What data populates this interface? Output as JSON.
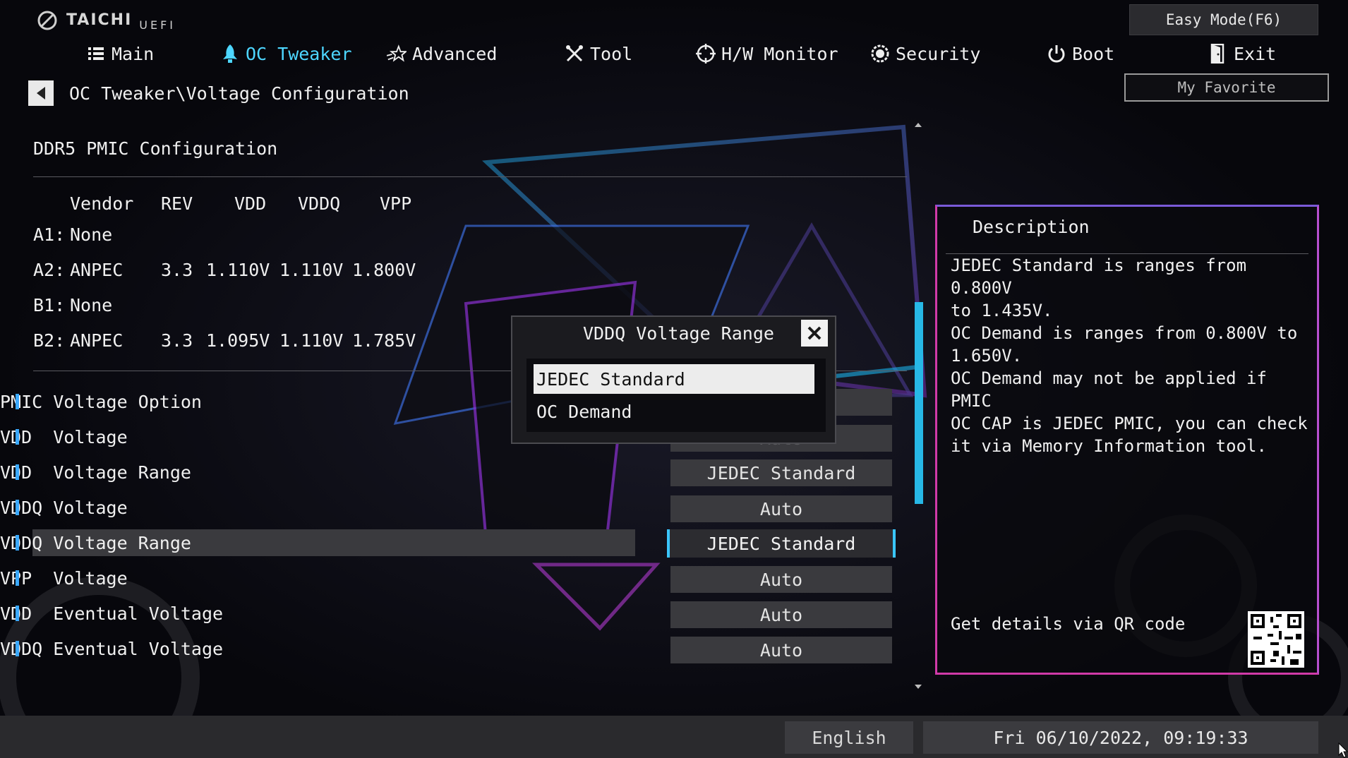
{
  "header": {
    "brand": "TAICHI",
    "brand_sub": "UEFI",
    "easy_mode": "Easy Mode(F6)",
    "my_favorite": "My Favorite"
  },
  "nav": [
    {
      "label": "Main",
      "icon": "list-icon"
    },
    {
      "label": "OC Tweaker",
      "icon": "rocket-icon",
      "active": true
    },
    {
      "label": "Advanced",
      "icon": "star-icon"
    },
    {
      "label": "Tool",
      "icon": "tools-icon"
    },
    {
      "label": "H/W Monitor",
      "icon": "crosshair-icon"
    },
    {
      "label": "Security",
      "icon": "shield-icon"
    },
    {
      "label": "Boot",
      "icon": "power-icon"
    },
    {
      "label": "Exit",
      "icon": "exit-door-icon"
    }
  ],
  "breadcrumb": "OC Tweaker\\Voltage Configuration",
  "section_title": "DDR5 PMIC Configuration",
  "pmic_table": {
    "headers": [
      "Vendor",
      "REV",
      "VDD",
      "VDDQ",
      "VPP"
    ],
    "rows": [
      {
        "slot": "A1:",
        "vendor": "None",
        "rev": "",
        "vdd": "",
        "vddq": "",
        "vpp": ""
      },
      {
        "slot": "A2:",
        "vendor": "ANPEC",
        "rev": "3.3",
        "vdd": "1.110V",
        "vddq": "1.110V",
        "vpp": "1.800V"
      },
      {
        "slot": "B1:",
        "vendor": "None",
        "rev": "",
        "vdd": "",
        "vddq": "",
        "vpp": ""
      },
      {
        "slot": "B2:",
        "vendor": "ANPEC",
        "rev": "3.3",
        "vdd": "1.095V",
        "vddq": "1.110V",
        "vpp": "1.785V"
      }
    ]
  },
  "settings": [
    {
      "label": "PMIC Voltage Option",
      "value": ""
    },
    {
      "label": "VDD  Voltage",
      "value": "Auto"
    },
    {
      "label": "VDD  Voltage Range",
      "value": "JEDEC Standard"
    },
    {
      "label": "VDDQ Voltage",
      "value": "Auto"
    },
    {
      "label": "VDDQ Voltage Range",
      "value": "JEDEC Standard",
      "selected": true
    },
    {
      "label": "VPP  Voltage",
      "value": "Auto"
    },
    {
      "label": "VDD  Eventual Voltage",
      "value": "Auto"
    },
    {
      "label": "VDDQ Eventual Voltage",
      "value": "Auto"
    }
  ],
  "description": {
    "title": "Description",
    "lines": [
      "JEDEC Standard is ranges from 0.800V",
      "to 1.435V.",
      "OC Demand is ranges from 0.800V to",
      "1.650V.",
      "OC Demand may not be applied if PMIC",
      "OC CAP is JEDEC PMIC, you can check",
      "it via Memory Information tool."
    ],
    "qr_text": "Get details via QR code"
  },
  "dialog": {
    "title": "VDDQ Voltage Range",
    "options": [
      "JEDEC Standard",
      "OC Demand"
    ],
    "selected_index": 0
  },
  "footer": {
    "language": "English",
    "datetime": "Fri 06/10/2022, 09:19:33"
  },
  "colors": {
    "accent": "#3ac6ff",
    "panel_border": "#d03aa8",
    "bar": "#3aa9ff"
  }
}
